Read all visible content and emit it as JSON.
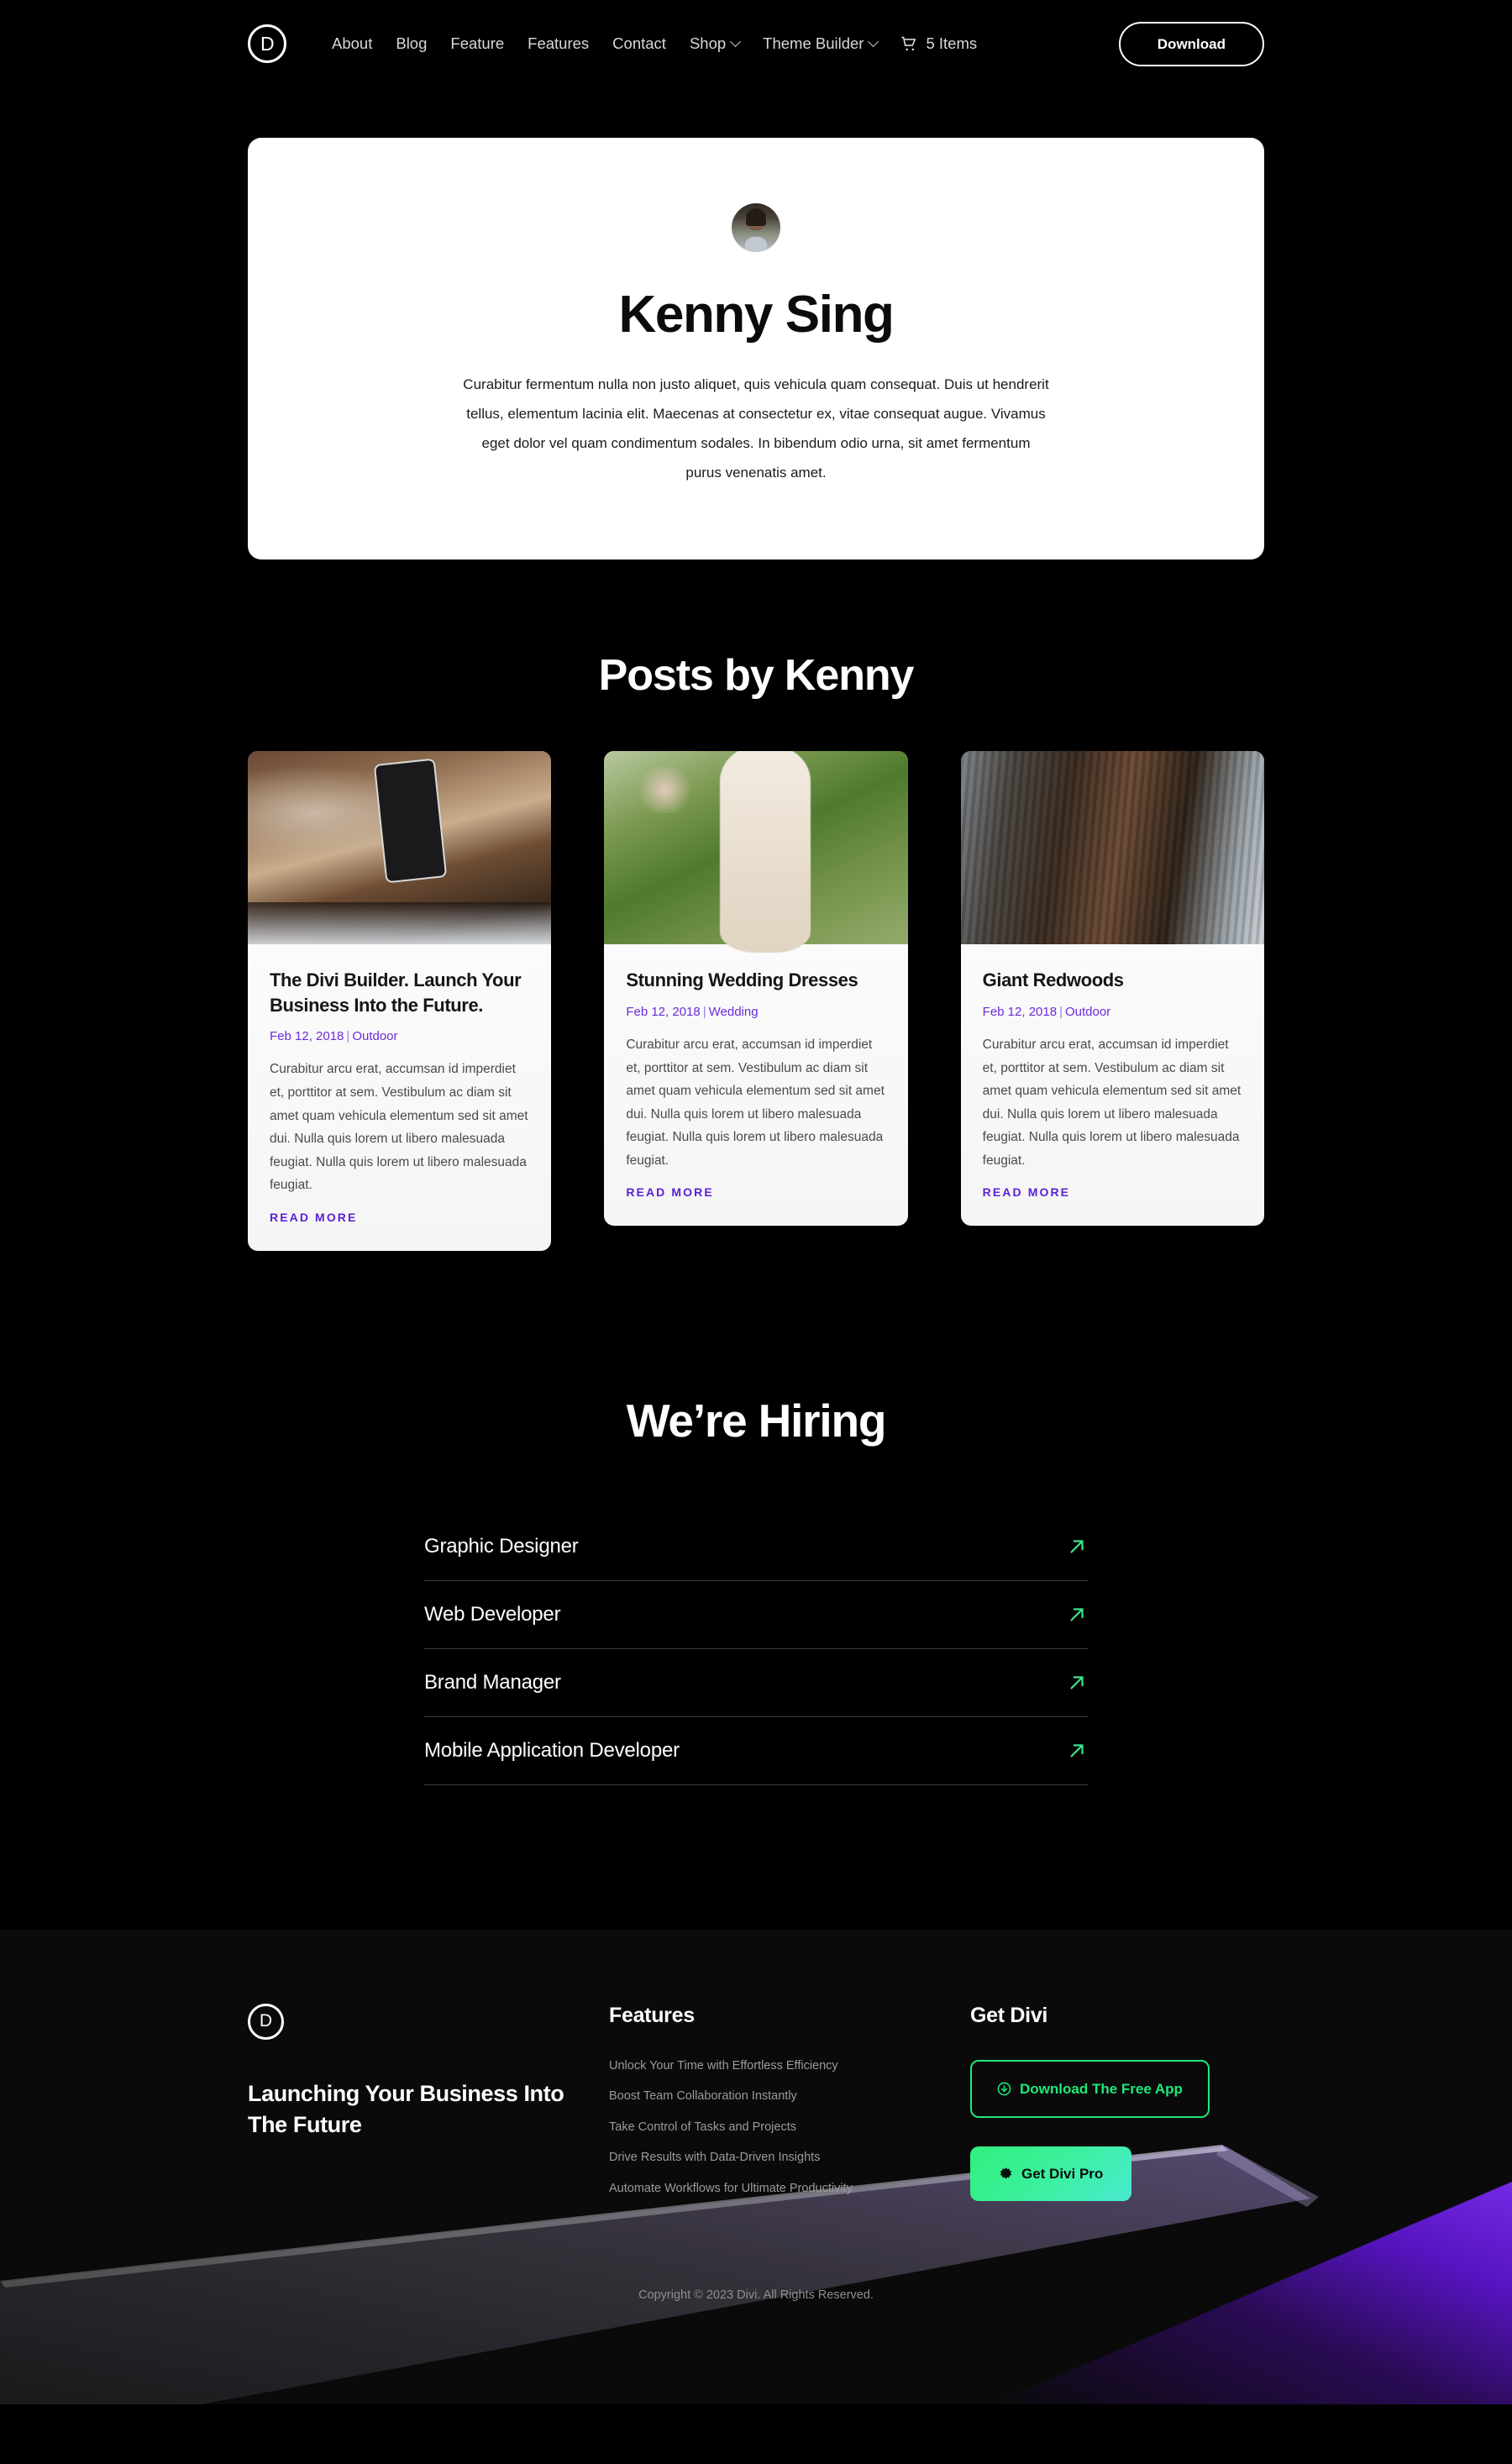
{
  "header": {
    "logo_letter": "D",
    "logo_icon": "divi-logo-icon",
    "nav": [
      {
        "label": "About",
        "caret": false
      },
      {
        "label": "Blog",
        "caret": false
      },
      {
        "label": "Feature",
        "caret": false
      },
      {
        "label": "Features",
        "caret": false
      },
      {
        "label": "Contact",
        "caret": false
      },
      {
        "label": "Shop",
        "caret": true
      },
      {
        "label": "Theme Builder",
        "caret": true
      }
    ],
    "cart_label": "5 Items",
    "cart_icon": "shopping-cart-icon",
    "download_label": "Download"
  },
  "hero": {
    "avatar_icon": "author-avatar",
    "name": "Kenny Sing",
    "bio": "Curabitur fermentum nulla non justo aliquet, quis vehicula quam consequat. Duis ut hendrerit tellus, elementum lacinia elit. Maecenas at consectetur ex, vitae consequat augue. Vivamus eget dolor vel quam condimentum sodales. In bibendum odio urna, sit amet fermentum purus venenatis amet."
  },
  "posts": {
    "title": "Posts by Kenny",
    "read_more_label": "READ MORE",
    "items": [
      {
        "title": "The Divi Builder. Launch Your Business Into the Future.",
        "date": "Feb 12, 2018",
        "category": "Outdoor",
        "excerpt": "Curabitur arcu erat, accumsan id imperdiet et, porttitor at sem. Vestibulum ac diam sit amet quam vehicula elementum sed sit amet dui. Nulla quis lorem ut libero malesuada feugiat. Nulla quis lorem ut libero malesuada feugiat.",
        "thumb": "phone-on-desk-photo"
      },
      {
        "title": "Stunning Wedding Dresses",
        "date": "Feb 12, 2018",
        "category": "Wedding",
        "excerpt": "Curabitur arcu erat, accumsan id imperdiet et, porttitor at sem. Vestibulum ac diam sit amet quam vehicula elementum sed sit amet dui. Nulla quis lorem ut libero malesuada feugiat. Nulla quis lorem ut libero malesuada feugiat.",
        "thumb": "wedding-dress-photo"
      },
      {
        "title": "Giant Redwoods",
        "date": "Feb 12, 2018",
        "category": "Outdoor",
        "excerpt": "Curabitur arcu erat, accumsan id imperdiet et, porttitor at sem. Vestibulum ac diam sit amet quam vehicula elementum sed sit amet dui. Nulla quis lorem ut libero malesuada feugiat. Nulla quis lorem ut libero malesuada feugiat.",
        "thumb": "redwood-trees-photo"
      }
    ]
  },
  "hiring": {
    "title": "We’re Hiring",
    "arrow_icon": "arrow-up-right-icon",
    "jobs": [
      {
        "label": "Graphic Designer"
      },
      {
        "label": "Web Developer"
      },
      {
        "label": "Brand Manager"
      },
      {
        "label": "Mobile Application Developer"
      }
    ]
  },
  "footer": {
    "logo_letter": "D",
    "tagline": "Launching Your Business Into The Future",
    "features_heading": "Features",
    "features": [
      "Unlock Your Time with Effortless Efficiency",
      "Boost Team Collaboration Instantly",
      "Take Control of Tasks and Projects",
      "Drive Results with Data-Driven Insights",
      "Automate Workflows for Ultimate Productivity"
    ],
    "get_heading": "Get Divi",
    "free_button": "Download The Free App",
    "free_button_icon": "download-circle-icon",
    "pro_button": "Get Divi Pro",
    "pro_button_icon": "badge-star-icon",
    "copyright": "Copyright © 2023 Divi. All Rights Reserved."
  },
  "colors": {
    "page_bg": "#000000",
    "card_bg": "#ffffff",
    "accent_purple": "#6c2bd9",
    "accent_green": "#1ee87a",
    "pro_gradient_start": "#2ff07c",
    "pro_gradient_end": "#4ae9d0",
    "footer_bg": "#0a0a0a",
    "muted_text": "#9b9b9b"
  }
}
